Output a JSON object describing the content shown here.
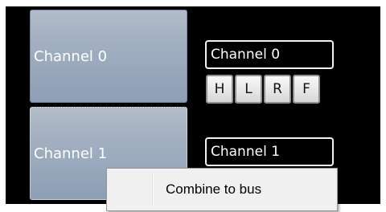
{
  "channels": [
    {
      "button_label": "Channel 0",
      "name_value": "Channel 0",
      "buttons": [
        "H",
        "L",
        "R",
        "F"
      ]
    },
    {
      "button_label": "Channel 1",
      "name_value": "Channel 1"
    }
  ],
  "context_menu": {
    "items": [
      "Combine to bus"
    ]
  }
}
